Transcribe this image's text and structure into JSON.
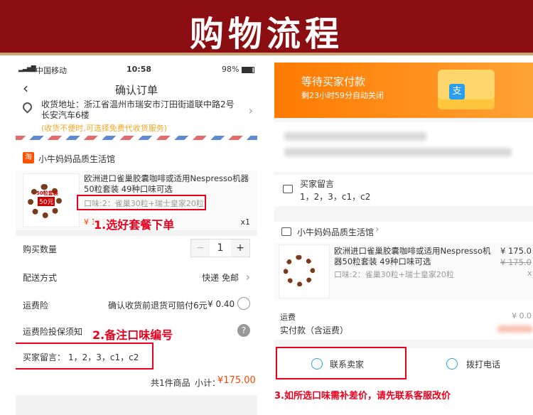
{
  "banner": {
    "title": "购物流程"
  },
  "left": {
    "status": {
      "carrier": "中国移动",
      "time": "10:58",
      "battery": "98%"
    },
    "nav_title": "确认订单",
    "address": {
      "text": "收货地址：浙江省温州市瑞安市汀田街道联中路2号 长安汽车6楼",
      "hint": "(收货不便时,可选择免费代收货服务)"
    },
    "shop_name": "小牛妈妈品质生活馆",
    "product": {
      "title": "欧洲进口雀巢胶囊咖啡或适用Nespresso机器50粒套装 49种口味可选",
      "flavor": "口味:2：雀巢30粒+瑞士皇家20粒",
      "price_prefix": "¥ 175",
      "qty": "x1",
      "thumb_badge": "50粒套装",
      "thumb_badge2": "50元"
    },
    "annot1": "1.选好套餐下单",
    "buy_qty": {
      "label": "购买数量",
      "minus": "−",
      "value": "1",
      "plus": "+"
    },
    "delivery": {
      "label": "配送方式",
      "value": "快递 免邮"
    },
    "insurance": {
      "label": "运费险",
      "desc": "确认收货前退货可赔付6元",
      "price": "¥ 0.40"
    },
    "insurance_notice": {
      "label": "运费险投保须知"
    },
    "annot2": "2.备注口味编号",
    "message": {
      "label": "买家留言：",
      "value": "1，2，3，c1，c2"
    },
    "summary": {
      "count": "共1件商品",
      "subtotal_label": "小计：",
      "subtotal": "¥175.00"
    }
  },
  "right": {
    "wait": {
      "title": "等待买家付款",
      "sub": "剩23小时59分自动关闭"
    },
    "message": {
      "label": "买家留言",
      "value": "1，2，3，c1，c2"
    },
    "shop_name": "小牛妈妈品质生活馆",
    "product": {
      "title": "欧洲进口雀巢胶囊咖啡或适用Nespresso机器50粒套装 49种口味可选",
      "flavor": "口味:2：雀巢30粒+瑞士皇家20粒",
      "price": "¥ 175.0",
      "orig_price": "¥ 175.0",
      "qty": "x"
    },
    "freight": {
      "label": "运费",
      "value": "¥ 0.0"
    },
    "paid": {
      "label": "实付款（含运费）"
    },
    "contact_seller": "联系卖家",
    "call": "拨打电话",
    "annot3": "3.如所选口味需补差价，请先联系客服改价"
  },
  "colors": {
    "banner": "#8b0e13",
    "accent_red": "#e8001c",
    "orange": "#ff8a00",
    "price": "#f40"
  }
}
